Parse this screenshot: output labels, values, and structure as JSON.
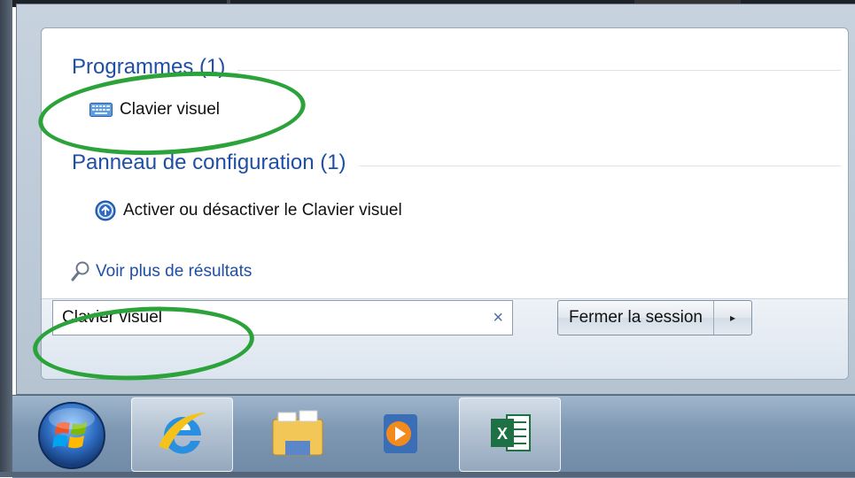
{
  "sections": {
    "programs": {
      "header": "Programmes (1)",
      "items": [
        {
          "label": "Clavier visuel",
          "icon": "keyboard-icon"
        }
      ]
    },
    "control_panel": {
      "header": "Panneau de configuration (1)",
      "items": [
        {
          "label": "Activer ou désactiver le Clavier visuel",
          "icon": "ease-of-access-icon"
        }
      ]
    }
  },
  "more_results": {
    "label": "Voir plus de résultats",
    "icon": "search-icon"
  },
  "search": {
    "value": "Clavier visuel",
    "clear_icon": "×"
  },
  "shutdown": {
    "label": "Fermer la session",
    "arrow_icon": "▸"
  },
  "taskbar": {
    "items": [
      {
        "name": "start-orb",
        "icon": "windows-logo-icon"
      },
      {
        "name": "internet-explorer",
        "icon": "ie-icon"
      },
      {
        "name": "file-explorer",
        "icon": "folder-icon"
      },
      {
        "name": "media-player",
        "icon": "media-player-icon"
      },
      {
        "name": "excel",
        "icon": "excel-icon"
      }
    ]
  },
  "colors": {
    "accent": "#1f4fa5",
    "annotation": "#2ba33a"
  }
}
